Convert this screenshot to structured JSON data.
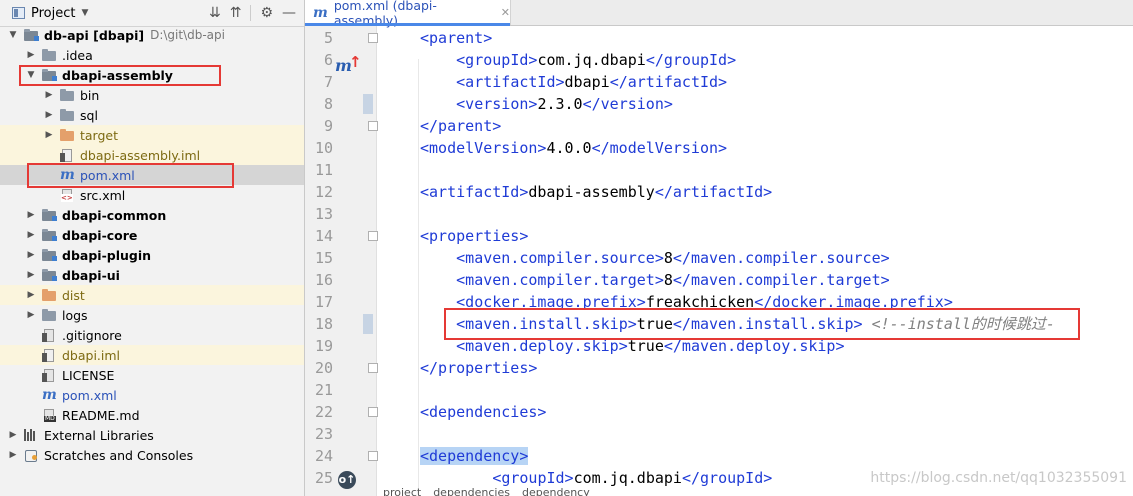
{
  "project_panel": {
    "title": "Project",
    "tree": [
      {
        "label": "db-api [dbapi]",
        "path": "D:\\git\\db-api",
        "bold": true,
        "depth": 0,
        "arrow": "down",
        "icon": "folder-module-icon"
      },
      {
        "label": ".idea",
        "depth": 1,
        "arrow": "right",
        "icon": "folder-icon"
      },
      {
        "label": "dbapi-assembly",
        "bold": true,
        "depth": 1,
        "arrow": "down",
        "icon": "folder-module-icon"
      },
      {
        "label": "bin",
        "depth": 2,
        "arrow": "right",
        "icon": "folder-icon"
      },
      {
        "label": "sql",
        "depth": 2,
        "arrow": "right",
        "icon": "folder-icon"
      },
      {
        "label": "target",
        "depth": 2,
        "arrow": "right",
        "icon": "folder-orange-icon",
        "style": "excluded"
      },
      {
        "label": "dbapi-assembly.iml",
        "depth": 2,
        "icon": "iml-file-icon",
        "style": "excluded"
      },
      {
        "label": "pom.xml",
        "depth": 2,
        "icon": "maven-icon",
        "style": "selected"
      },
      {
        "label": "src.xml",
        "depth": 2,
        "icon": "xml-file-icon"
      },
      {
        "label": "dbapi-common",
        "bold": true,
        "depth": 1,
        "arrow": "right",
        "icon": "folder-module-icon"
      },
      {
        "label": "dbapi-core",
        "bold": true,
        "depth": 1,
        "arrow": "right",
        "icon": "folder-module-icon"
      },
      {
        "label": "dbapi-plugin",
        "bold": true,
        "depth": 1,
        "arrow": "right",
        "icon": "folder-module-icon"
      },
      {
        "label": "dbapi-ui",
        "bold": true,
        "depth": 1,
        "arrow": "right",
        "icon": "folder-module-icon"
      },
      {
        "label": "dist",
        "depth": 1,
        "arrow": "right",
        "icon": "folder-orange-icon",
        "style": "excluded"
      },
      {
        "label": "logs",
        "depth": 1,
        "arrow": "right",
        "icon": "folder-icon"
      },
      {
        "label": ".gitignore",
        "depth": 1,
        "icon": "gitignore-file-icon"
      },
      {
        "label": "dbapi.iml",
        "depth": 1,
        "icon": "iml-file-icon",
        "style": "excluded"
      },
      {
        "label": "LICENSE",
        "depth": 1,
        "icon": "license-file-icon"
      },
      {
        "label": "pom.xml",
        "depth": 1,
        "icon": "maven-icon"
      },
      {
        "label": "README.md",
        "depth": 1,
        "icon": "markdown-file-icon"
      },
      {
        "label": "External Libraries",
        "depth": 0,
        "arrow": "right",
        "icon": "libraries-icon"
      },
      {
        "label": "Scratches and Consoles",
        "depth": 0,
        "arrow": "right",
        "icon": "scratches-icon"
      }
    ]
  },
  "editor": {
    "tab_label": "pom.xml (dbapi-assembly)",
    "lines": [
      {
        "n": "5",
        "indent": 1,
        "parts": [
          [
            "t",
            "<parent>"
          ]
        ]
      },
      {
        "n": "6",
        "indent": 2,
        "parts": [
          [
            "t",
            "<groupId>"
          ],
          [
            "x",
            "com.jq.dbapi"
          ],
          [
            "t",
            "</groupId>"
          ]
        ]
      },
      {
        "n": "7",
        "indent": 2,
        "parts": [
          [
            "t",
            "<artifactId>"
          ],
          [
            "x",
            "dbapi"
          ],
          [
            "t",
            "</artifactId>"
          ]
        ]
      },
      {
        "n": "8",
        "indent": 2,
        "parts": [
          [
            "t",
            "<version>"
          ],
          [
            "x",
            "2.3.0"
          ],
          [
            "t",
            "</version>"
          ]
        ]
      },
      {
        "n": "9",
        "indent": 1,
        "parts": [
          [
            "t",
            "</parent>"
          ]
        ]
      },
      {
        "n": "10",
        "indent": 1,
        "parts": [
          [
            "t",
            "<modelVersion>"
          ],
          [
            "x",
            "4.0.0"
          ],
          [
            "t",
            "</modelVersion>"
          ]
        ]
      },
      {
        "n": "11",
        "indent": 1,
        "parts": []
      },
      {
        "n": "12",
        "indent": 1,
        "parts": [
          [
            "t",
            "<artifactId>"
          ],
          [
            "x",
            "dbapi-assembly"
          ],
          [
            "t",
            "</artifactId>"
          ]
        ]
      },
      {
        "n": "13",
        "indent": 1,
        "parts": []
      },
      {
        "n": "14",
        "indent": 1,
        "parts": [
          [
            "t",
            "<properties>"
          ]
        ]
      },
      {
        "n": "15",
        "indent": 2,
        "parts": [
          [
            "t",
            "<maven.compiler.source>"
          ],
          [
            "x",
            "8"
          ],
          [
            "t",
            "</maven.compiler.source>"
          ]
        ]
      },
      {
        "n": "16",
        "indent": 2,
        "parts": [
          [
            "t",
            "<maven.compiler.target>"
          ],
          [
            "x",
            "8"
          ],
          [
            "t",
            "</maven.compiler.target>"
          ]
        ]
      },
      {
        "n": "17",
        "indent": 2,
        "parts": [
          [
            "t",
            "<docker.image.prefix>"
          ],
          [
            "x",
            "freakchicken"
          ],
          [
            "t",
            "</docker.image.prefix>"
          ]
        ]
      },
      {
        "n": "18",
        "indent": 2,
        "parts": [
          [
            "t",
            "<maven.install.skip>"
          ],
          [
            "x",
            "true"
          ],
          [
            "t",
            "</maven.install.skip>"
          ],
          [
            "x",
            " "
          ],
          [
            "c",
            "<!--install的时候跳过-"
          ]
        ]
      },
      {
        "n": "19",
        "indent": 2,
        "parts": [
          [
            "t",
            "<maven.deploy.skip>"
          ],
          [
            "x",
            "true"
          ],
          [
            "t",
            "</maven.deploy.skip>"
          ]
        ]
      },
      {
        "n": "20",
        "indent": 1,
        "parts": [
          [
            "t",
            "</properties>"
          ]
        ]
      },
      {
        "n": "21",
        "indent": 1,
        "parts": []
      },
      {
        "n": "22",
        "indent": 1,
        "parts": [
          [
            "t",
            "<dependencies>"
          ]
        ]
      },
      {
        "n": "23",
        "indent": 1,
        "parts": []
      },
      {
        "n": "24",
        "indent": 1,
        "parts": [
          [
            "h",
            "<dependency>"
          ]
        ]
      },
      {
        "n": "25",
        "indent": 3,
        "parts": [
          [
            "t",
            "<groupId>"
          ],
          [
            "x",
            "com.jq.dbapi"
          ],
          [
            "t",
            "</groupId>"
          ]
        ]
      }
    ],
    "breadcrumbs": [
      "project",
      "dependencies",
      "dependency"
    ],
    "watermark": "https://blog.csdn.net/qq1032355091"
  }
}
